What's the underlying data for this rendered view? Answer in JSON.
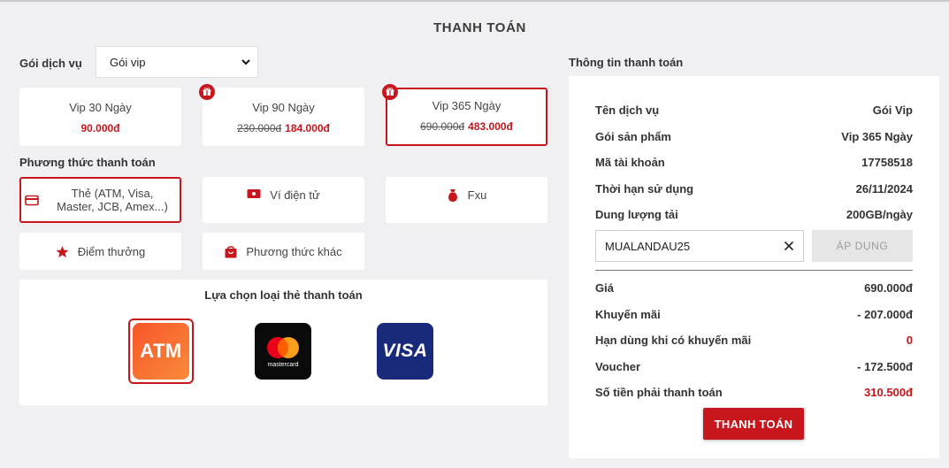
{
  "page": {
    "title": "THANH TOÁN"
  },
  "service": {
    "label": "Gói dịch vụ",
    "selected": "Gói vip"
  },
  "packages": [
    {
      "name": "Vip 30 Ngày",
      "old_price": "",
      "price": "90.000đ",
      "gift": false,
      "selected": false
    },
    {
      "name": "Vip 90 Ngày",
      "old_price": "230.000đ",
      "price": "184.000đ",
      "gift": true,
      "selected": false
    },
    {
      "name": "Vip 365 Ngày",
      "old_price": "690.000đ",
      "price": "483.000đ",
      "gift": true,
      "selected": true
    }
  ],
  "payment_methods": {
    "label": "Phương thức thanh toán",
    "items": [
      {
        "label": "Thẻ (ATM, Visa, Master, JCB, Amex...)",
        "icon": "credit-card-icon",
        "selected": true
      },
      {
        "label": "Ví điện tử",
        "icon": "wallet-icon",
        "selected": false
      },
      {
        "label": "Fxu",
        "icon": "money-bag-icon",
        "selected": false
      },
      {
        "label": "Điểm thưởng",
        "icon": "star-icon",
        "selected": false
      },
      {
        "label": "Phương thức khác",
        "icon": "shopping-bag-icon",
        "selected": false
      }
    ]
  },
  "card_types": {
    "title": "Lựa chọn loại thẻ thanh toán",
    "atm": "ATM",
    "mastercard": "mastercard",
    "visa": "VISA"
  },
  "info": {
    "label": "Thông tin thanh toán",
    "rows": [
      {
        "key": "Tên dịch vụ",
        "value": "Gói Vip"
      },
      {
        "key": "Gói sản phẩm",
        "value": "Vip 365 Ngày"
      },
      {
        "key": "Mã tài khoản",
        "value": "17758518"
      },
      {
        "key": "Thời hạn sử dụng",
        "value": "26/11/2024"
      },
      {
        "key": "Dung lượng tải",
        "value": "200GB/ngày"
      }
    ],
    "coupon_value": "MUALANDAU25",
    "apply_label": "ÁP DỤNG",
    "summary": [
      {
        "key": "Giá",
        "value": "690.000đ"
      },
      {
        "key": "Khuyến mãi",
        "value": "- 207.000đ"
      },
      {
        "key": "Hạn dùng khi có khuyến mãi",
        "value": "0"
      },
      {
        "key": "Voucher",
        "value": "- 172.500đ"
      },
      {
        "key": "Số tiền phải thanh toán",
        "value": "310.500đ"
      }
    ],
    "pay_label": "THANH TOÁN"
  },
  "colors": {
    "accent": "#c8161d",
    "background": "#f0f0f3"
  }
}
